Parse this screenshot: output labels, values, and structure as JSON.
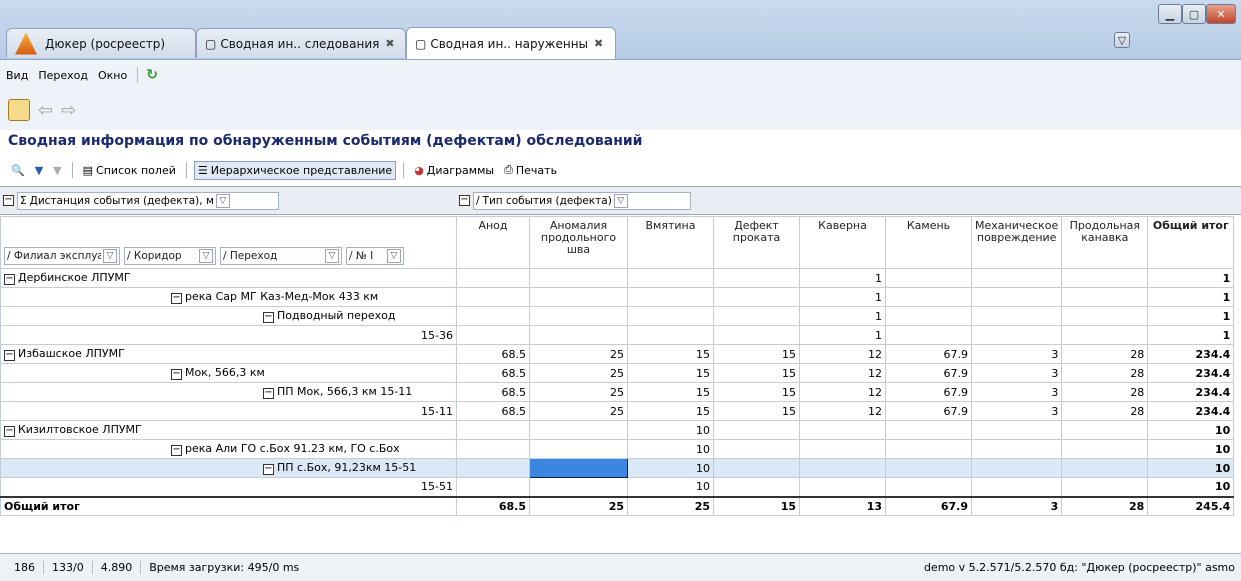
{
  "tabs": [
    {
      "label": "Дюкер (росреестр)",
      "active": false
    },
    {
      "label": "Сводная ин.. следования",
      "active": false
    },
    {
      "label": "Сводная ин.. наруженны",
      "active": true
    }
  ],
  "menu": [
    "Вид",
    "Переход",
    "Окно"
  ],
  "page_title": "Сводная информация по обнаруженным событиям (дефектам) обследований",
  "toolbar": {
    "fields": "Список полей",
    "hier": "Иерархическое представление",
    "charts": "Диаграммы",
    "print": "Печать"
  },
  "row_area": {
    "data_field": "Дистанция события (дефекта), м",
    "col_field": "Тип события (дефекта)",
    "row_fields": [
      "Филиал эксплуат",
      "Коридор",
      "Переход",
      "№ I"
    ]
  },
  "columns": [
    "Анод",
    "Аномалия продольного шва",
    "Вмятина",
    "Дефект проката",
    "Каверна",
    "Камень",
    "Механическое повреждение",
    "Продольная канавка",
    "Общий итог"
  ],
  "rows": [
    {
      "label": "Дербинское ЛПУМГ",
      "level": 0,
      "cells": [
        "",
        "",
        "",
        "",
        "1",
        "",
        "",
        "",
        "1"
      ]
    },
    {
      "label": "река Сар МГ Каз-Мед-Мок 433 км",
      "level": 1,
      "cells": [
        "",
        "",
        "",
        "",
        "1",
        "",
        "",
        "",
        "1"
      ]
    },
    {
      "label": "Подводный переход",
      "level": 2,
      "cells": [
        "",
        "",
        "",
        "",
        "1",
        "",
        "",
        "",
        "1"
      ]
    },
    {
      "label": "15-36",
      "level": 3,
      "cells": [
        "",
        "",
        "",
        "",
        "1",
        "",
        "",
        "",
        "1"
      ]
    },
    {
      "label": "Избашское ЛПУМГ",
      "level": 0,
      "cells": [
        "68.5",
        "25",
        "15",
        "15",
        "12",
        "67.9",
        "3",
        "28",
        "234.4"
      ]
    },
    {
      "label": "Мок, 566,3 км",
      "level": 1,
      "cells": [
        "68.5",
        "25",
        "15",
        "15",
        "12",
        "67.9",
        "3",
        "28",
        "234.4"
      ]
    },
    {
      "label": "ПП Мок, 566,3 км 15-11",
      "level": 2,
      "cells": [
        "68.5",
        "25",
        "15",
        "15",
        "12",
        "67.9",
        "3",
        "28",
        "234.4"
      ]
    },
    {
      "label": "15-11",
      "level": 3,
      "cells": [
        "68.5",
        "25",
        "15",
        "15",
        "12",
        "67.9",
        "3",
        "28",
        "234.4"
      ]
    },
    {
      "label": "Кизилтовское ЛПУМГ",
      "level": 0,
      "cells": [
        "",
        "",
        "10",
        "",
        "",
        "",
        "",
        "",
        "10"
      ]
    },
    {
      "label": "река Али ГО с.Бох 91.23 км, ГО с.Бох",
      "level": 1,
      "cells": [
        "",
        "",
        "10",
        "",
        "",
        "",
        "",
        "",
        "10"
      ]
    },
    {
      "label": "ПП с.Бох, 91,23км 15-51",
      "level": 2,
      "cells": [
        "",
        "",
        "10",
        "",
        "",
        "",
        "",
        "",
        "10"
      ],
      "selected": true
    },
    {
      "label": "15-51",
      "level": 3,
      "cells": [
        "",
        "",
        "10",
        "",
        "",
        "",
        "",
        "",
        "10"
      ]
    }
  ],
  "total": {
    "label": "Общий итог",
    "cells": [
      "68.5",
      "25",
      "25",
      "15",
      "13",
      "67.9",
      "3",
      "28",
      "245.4"
    ]
  },
  "status": {
    "a": "186",
    "b": "133/0",
    "c": "4.890",
    "load": "Время загрузки: 495/0 ms",
    "right": "demo  v 5.2.571/5.2.570  бд: \"Дюкер (росреестр)\" asmo"
  }
}
